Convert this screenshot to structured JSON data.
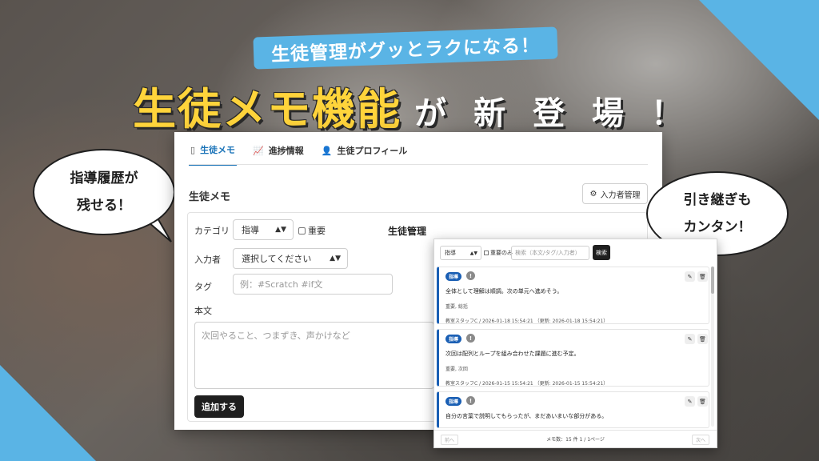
{
  "banner": {
    "subtitle": "生徒管理がグッとラクになる！",
    "headline_accent": "生徒メモ機能",
    "headline_rest": "が 新 登 場 ！"
  },
  "bubbles": {
    "left": [
      "指導履歴が",
      "残せる！"
    ],
    "right": [
      "引き継ぎも",
      "カンタン！"
    ]
  },
  "tabs": [
    {
      "label": "生徒メモ",
      "icon": "memo-icon",
      "glyph": "▯",
      "active": true
    },
    {
      "label": "進捗情報",
      "icon": "chart-icon",
      "glyph": "📈",
      "active": false
    },
    {
      "label": "生徒プロフィール",
      "icon": "person-icon",
      "glyph": "👤",
      "active": false
    }
  ],
  "memo_form": {
    "title": "生徒メモ",
    "manage_button": "入力者管理",
    "category_label": "カテゴリ",
    "category_value": "指導",
    "important_label": "重要",
    "author_label": "入力者",
    "author_value": "選択してください",
    "tag_label": "タグ",
    "tag_placeholder": "例：#Scratch #if文",
    "body_label": "本文",
    "body_placeholder": "次回やること、つまずき、声かけなど",
    "add_button": "追加する",
    "side_heading": "生徒管理"
  },
  "memo_list": {
    "filter_value": "指導",
    "important_only": "重要のみ",
    "search_placeholder": "検索（本文/タグ/入力者）",
    "search_button": "検索",
    "items": [
      {
        "badge": "指導",
        "body": "全体として理解は順調。次の単元へ進めそう。",
        "tags": "重要, 総括",
        "meta": "教室スタッフC / 2026-01-18 15:54:21 （更新: 2026-01-18 15:54:21）"
      },
      {
        "badge": "指導",
        "body": "次回は配列とループを組み合わせた課題に進む予定。",
        "tags": "重要, 次回",
        "meta": "教室スタッフC / 2026-01-15 15:54:21 （更新: 2026-01-15 15:54:21）"
      },
      {
        "badge": "指導",
        "body": "自分の言葉で説明してもらったが、まだあいまいな部分がある。",
        "tags": "",
        "meta": ""
      }
    ],
    "prev_button": "前へ",
    "next_button": "次へ",
    "page_info": "メモ数：15 件 1 / 1ページ"
  },
  "colors": {
    "accent_blue": "#5ab4e5",
    "headline_yellow": "#ffd43b",
    "tab_active": "#1a73b8",
    "badge_blue": "#1a5fb4"
  }
}
